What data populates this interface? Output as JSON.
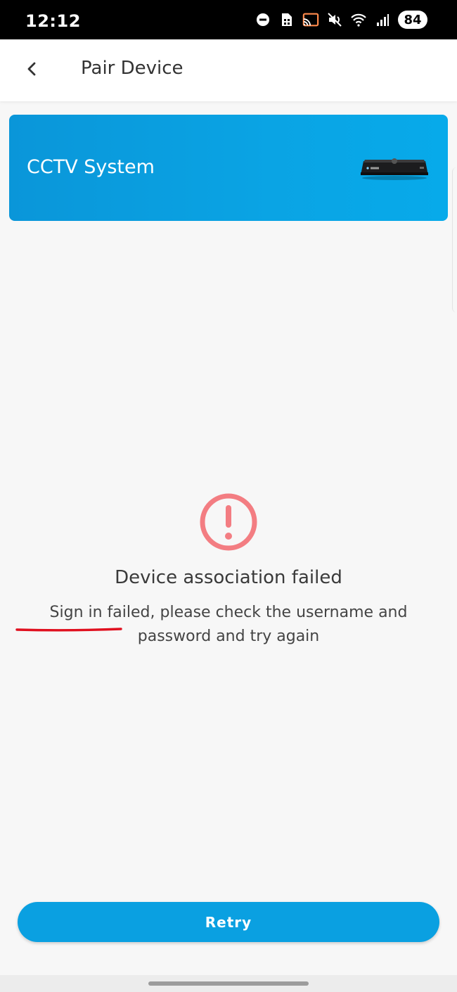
{
  "status_bar": {
    "time": "12:12",
    "battery": "84",
    "icons": [
      "do-not-disturb-icon",
      "sim-card-icon",
      "cast-icon",
      "mute-icon",
      "wifi-icon",
      "signal-icon"
    ]
  },
  "app_bar": {
    "title": "Pair Device",
    "back_icon": "chevron-left-icon"
  },
  "device_card": {
    "name": "CCTV System",
    "image_icon": "nvr-recorder-icon",
    "background_color": "#0aa4e4"
  },
  "result": {
    "icon": "exclamation-circle-icon",
    "icon_color": "#f37d82",
    "title": "Device association failed",
    "message": "Sign in failed, please check the username and password and try again",
    "underline_color": "#e0101f"
  },
  "actions": {
    "retry_label": "Retry",
    "accent": "#0aa0e1"
  }
}
